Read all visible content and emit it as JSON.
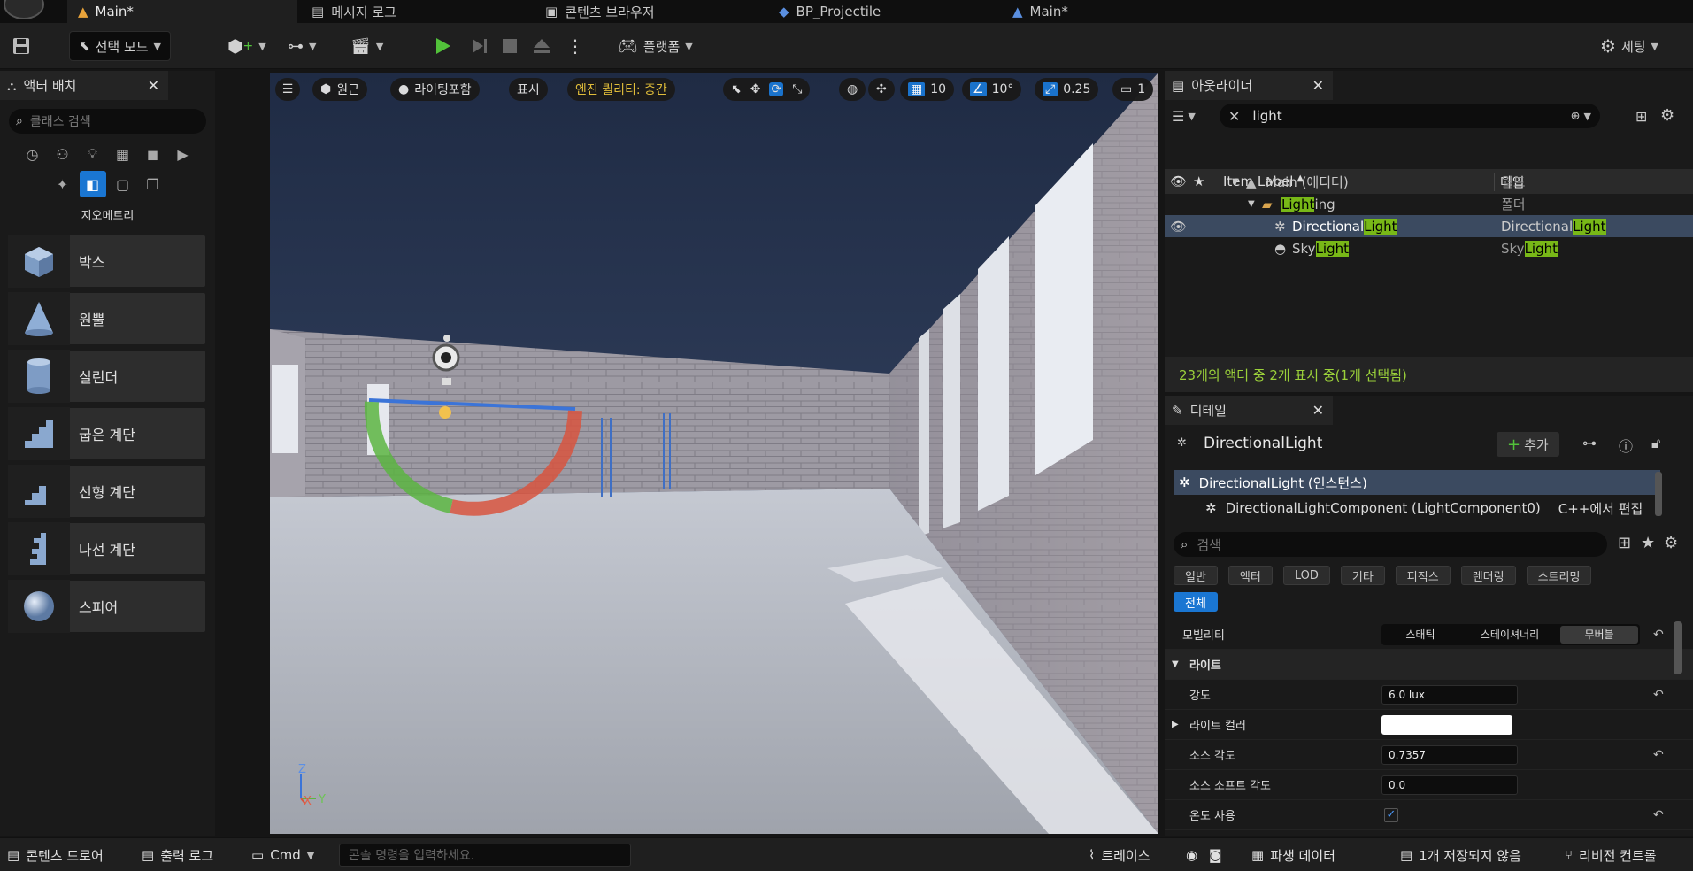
{
  "tabs": [
    {
      "label": "Main*",
      "active": true
    },
    {
      "label": "메시지 로그",
      "active": false
    },
    {
      "label": "콘텐츠 브라우저",
      "active": false
    },
    {
      "label": "BP_Projectile",
      "active": false
    },
    {
      "label": "Main*",
      "active": false
    }
  ],
  "toolbar": {
    "mode_label": "선택 모드",
    "platform_label": "플랫폼",
    "settings_label": "세팅"
  },
  "place_actors": {
    "tab_label": "액터 배치",
    "search_placeholder": "클래스 검색",
    "category_title": "지오메트리",
    "items": [
      "박스",
      "원뿔",
      "실린더",
      "굽은 계단",
      "선형 계단",
      "나선 계단",
      "스피어"
    ]
  },
  "viewport": {
    "perspective_label": "원근",
    "lighting_label": "라이팅포함",
    "show_label": "표시",
    "quality_label": "엔진 퀄리티: 중간",
    "grid_snap": "10",
    "rotation_snap": "10°",
    "scale_snap": "0.25",
    "camera_speed": "1",
    "axis_z": "Z",
    "axis_x": "X",
    "axis_y": "Y"
  },
  "outliner": {
    "tab_label": "아웃라이너",
    "filter_text": "light",
    "col_label": "Item Label",
    "col_type": "타입",
    "rows": [
      {
        "pre": "Main (에디터)",
        "hl": "",
        "post": "",
        "type_pre": "월드",
        "type_hl": "",
        "type_post": ""
      },
      {
        "pre": "",
        "hl": "Light",
        "post": "ing",
        "type_pre": "폴더",
        "type_hl": "",
        "type_post": ""
      },
      {
        "pre": "Directional",
        "hl": "Light",
        "post": "",
        "type_pre": "Directional",
        "type_hl": "Light",
        "type_post": ""
      },
      {
        "pre": "Sky",
        "hl": "Light",
        "post": "",
        "type_pre": "Sky",
        "type_hl": "Light",
        "type_post": ""
      }
    ],
    "count_text": "23개의 액터 중 2개 표시 중(1개 선택됨)"
  },
  "details": {
    "tab_label": "디테일",
    "object_name": "DirectionalLight",
    "add_label": "추가",
    "instance_label": "DirectionalLight (인스턴스)",
    "component_label": "DirectionalLightComponent (LightComponent0)",
    "edit_cpp_label": "C++에서 편집",
    "search_placeholder": "검색",
    "filter_tags": [
      "일반",
      "액터",
      "LOD",
      "기타",
      "피직스",
      "렌더링",
      "스트리밍"
    ],
    "all_tag": "전체",
    "mobility_label": "모빌리티",
    "mobility_options": [
      "스태틱",
      "스테이셔너리",
      "무버블"
    ],
    "light_section": "라이트",
    "intensity_label": "강도",
    "intensity_value": "6.0 lux",
    "light_color_label": "라이트 컬러",
    "source_angle_label": "소스 각도",
    "source_angle_value": "0.7357",
    "source_soft_angle_label": "소스 소프트 각도",
    "source_soft_angle_value": "0.0",
    "use_temperature_label": "온도 사용"
  },
  "statusbar": {
    "content_drawer": "콘텐츠 드로어",
    "output_log": "출력 로그",
    "cmd_label": "Cmd",
    "console_placeholder": "콘솔 명령을 입력하세요.",
    "trace_label": "트레이스",
    "derived_data_label": "파생 데이터",
    "unsaved_label": "1개 저장되지 않음",
    "revision_label": "리비전 컨트롤"
  },
  "colors": {
    "accent_blue": "#1a76d2",
    "highlight_green": "#78b817",
    "play_green": "#52c23a",
    "quality_yellow": "#e8c33a"
  }
}
